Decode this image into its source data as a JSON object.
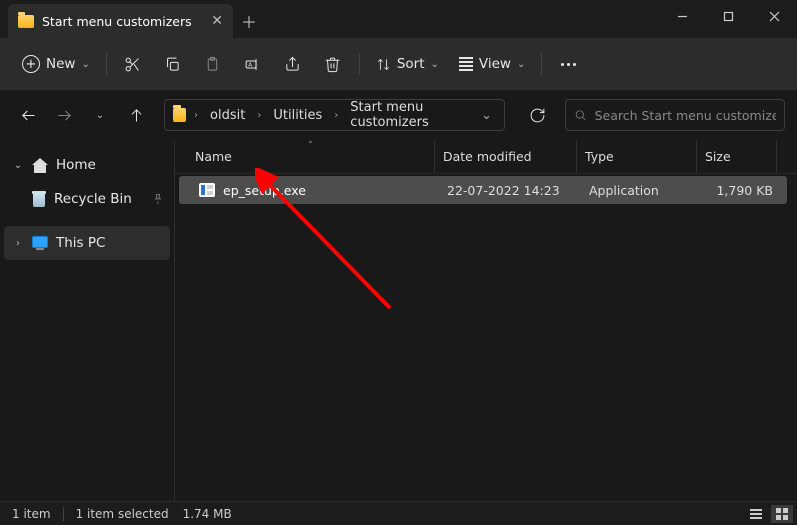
{
  "tab": {
    "title": "Start menu customizers"
  },
  "toolbar": {
    "new_label": "New",
    "sort_label": "Sort",
    "view_label": "View"
  },
  "breadcrumb": {
    "segments": [
      "oldsit",
      "Utilities",
      "Start menu customizers"
    ]
  },
  "search": {
    "placeholder": "Search Start menu customizers"
  },
  "sidebar": {
    "home": "Home",
    "recycle": "Recycle Bin",
    "thispc": "This PC"
  },
  "columns": {
    "name": "Name",
    "date": "Date modified",
    "type": "Type",
    "size": "Size"
  },
  "files": [
    {
      "name": "ep_setup.exe",
      "date": "22-07-2022 14:23",
      "type": "Application",
      "size": "1,790 KB",
      "selected": true
    }
  ],
  "status": {
    "count": "1 item",
    "selected": "1 item selected",
    "size": "1.74 MB"
  }
}
